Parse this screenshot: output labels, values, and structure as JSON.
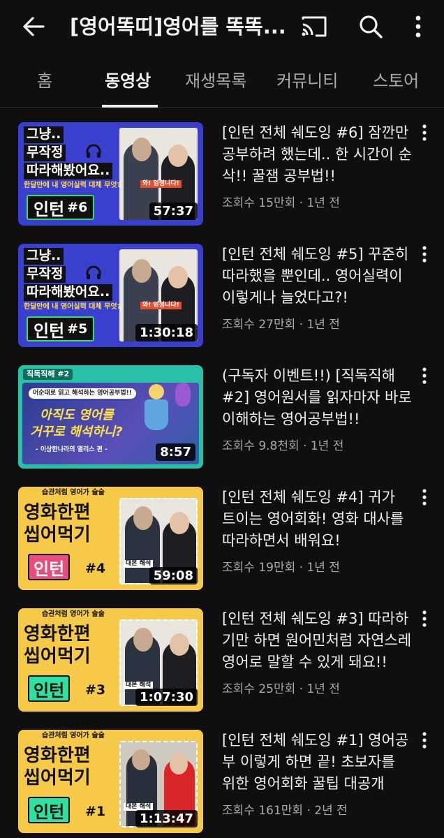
{
  "header": {
    "title": "[영어똑띠]영어를 똑똑...",
    "back_icon": "arrow-left-icon",
    "cast_icon": "cast-icon",
    "search_icon": "search-icon",
    "more_icon": "more-vert-icon"
  },
  "tabs": [
    {
      "label": "홈"
    },
    {
      "label": "동영상",
      "active": true
    },
    {
      "label": "재생목록"
    },
    {
      "label": "커뮤니티"
    },
    {
      "label": "스토어"
    }
  ],
  "videos": [
    {
      "title": "[인턴 전체 쉐도잉 #6] 잠깐만 공부하려 했는데.. 한 시간이 순삭!! 꿀잼 공부법!!",
      "meta": "조회수 15만회 · 1년 전",
      "duration": "57:37",
      "thumb": {
        "line1": "그냥..",
        "line2": "무작정",
        "line3": "따라해봤어요..",
        "sub": "한달만에 내 영어실력 대체 무엇??",
        "badge": "인턴",
        "num": "#6",
        "caption": "와! 엄청나다!"
      }
    },
    {
      "title": "[인턴 전체 쉐도잉 #5] 꾸준히 따라했을 뿐인데.. 영어실력이 이렇게나 늘었다고?!",
      "meta": "조회수 27만회 · 1년 전",
      "duration": "1:30:18",
      "thumb": {
        "line1": "그냥..",
        "line2": "무작정",
        "line3": "따라해봤어요..",
        "sub": "한달만에 내 영어실력 대체 무엇??",
        "badge": "인턴",
        "num": "#5",
        "caption": "와! 엄청나다!"
      }
    },
    {
      "title": "(구독자 이벤트!!) [직독직해 #2] 영어원서를 읽자마자 바로 이해하는 영어공부법!!",
      "meta": "조회수 9.8천회 · 1년 전",
      "duration": "8:57",
      "thumb": {
        "tag": "직독직해 #2",
        "bubble": "어순대로 읽고 해석하는 영어공부법!!",
        "line1": "아직도 영어를",
        "line2": "거꾸로 해석하니?",
        "sub": "- 이상한나라의 앨리스 편 -"
      }
    },
    {
      "title": "[인턴 전체 쉐도잉 #4] 귀가 트이는 영어회화! 영화 대사를 따라하면서 배워요!",
      "meta": "조회수 19만회 · 1년 전",
      "duration": "59:08",
      "thumb": {
        "top": "습관처럼 영어가 술술",
        "line1": "영화한편",
        "line2": "씹어먹기",
        "badge": "인턴",
        "num": "#4",
        "caption": "대본 해석"
      }
    },
    {
      "title": "[인턴 전체 쉐도잉 #3] 따라하기만 하면 원어민처럼 자연스레 영어로 말할 수 있게 돼요!!",
      "meta": "조회수 25만회 · 1년 전",
      "duration": "1:07:30",
      "thumb": {
        "top": "습관처럼 영어가 술술",
        "line1": "영화한편",
        "line2": "씹어먹기",
        "badge": "인턴",
        "num": "#3",
        "caption": "대본 해석"
      }
    },
    {
      "title": "[인턴 전체 쉐도잉 #1] 영어공부 이렇게 하면 끝! 초보자를 위한 영어회화 꿀팁 대공개",
      "meta": "조회수 161만회 · 2년 전",
      "duration": "1:13:47",
      "thumb": {
        "top": "습관처럼 영어가 술술",
        "line1": "영화한편",
        "line2": "씹어먹기",
        "badge": "인턴",
        "num": "#1",
        "caption": "대본 해석"
      }
    }
  ],
  "colors": {
    "background": "#0f0f0f",
    "text_primary": "#f1f1f1",
    "text_secondary": "#aaaaaa",
    "thumb_blue": "#3a3fcf",
    "thumb_teal": "#29c0a8",
    "thumb_yellow": "#f7c949"
  }
}
